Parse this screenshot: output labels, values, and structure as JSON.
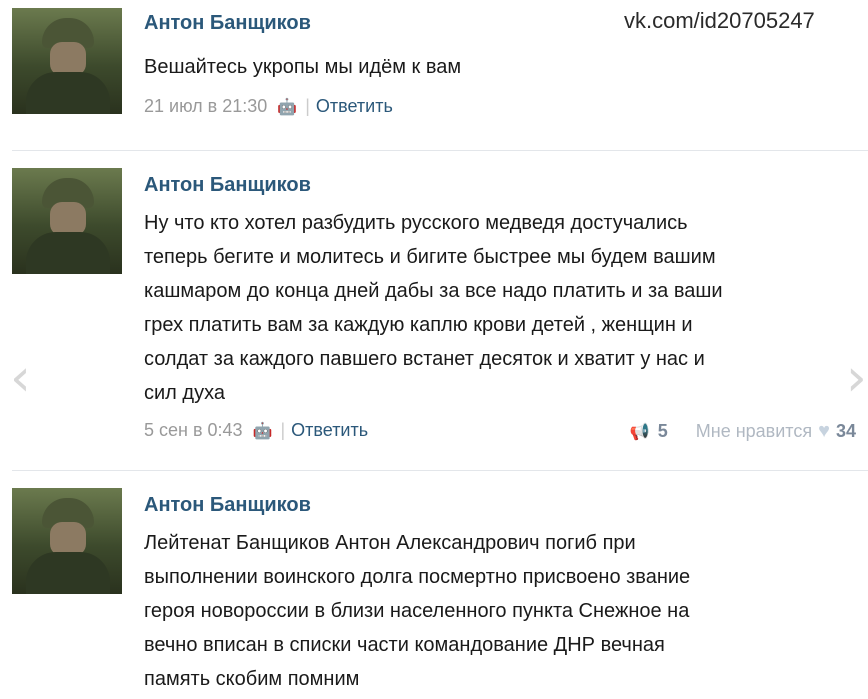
{
  "url": "vk.com/id20705247",
  "posts": [
    {
      "author": "Антон Банщиков",
      "lines": [
        "Вешайтесь укропы мы идём к вам"
      ],
      "date": "21 июл в 21:30",
      "reply": "Ответить"
    },
    {
      "author": "Антон Банщиков",
      "lines": [
        "Ну что кто хотел разбудить русского медведя достучались",
        "теперь бегите и молитесь и бигите быстрее мы будем вашим",
        "кашмаром до конца дней дабы за все надо платить и за ваши",
        "грех платить вам за каждую каплю крови детей , женщин и",
        "солдат за каждого павшего встанет десяток и хватит у нас и",
        "сил духа"
      ],
      "date": "5 сен в 0:43",
      "reply": "Ответить",
      "shares": "5",
      "like_label": "Мне нравится",
      "likes": "34"
    },
    {
      "author": "Антон Банщиков",
      "lines": [
        "Лейтенат Банщиков Антон Александрович погиб при",
        "выполнении воинского долга посмертно присвоено звание",
        "героя новороссии в близи населенного пункта Снежное на",
        "вечно вписан в списки части командование ДНР вечная",
        "память скобим помним"
      ]
    }
  ],
  "nav": {
    "prev": "‹",
    "next": "›"
  }
}
